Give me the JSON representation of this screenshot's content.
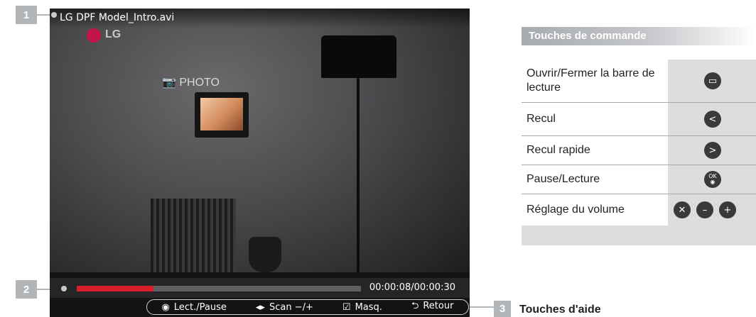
{
  "callouts": {
    "one": "1",
    "two": "2",
    "three": "3",
    "three_label": "Touches d'aide"
  },
  "player": {
    "file_title": "LG DPF Model_Intro.avi",
    "logo_text": "LG",
    "photo_label": "PHOTO",
    "progress": 0.27,
    "time_readout": "00:00:08/00:00:30",
    "help_bar": [
      {
        "glyph": "◉",
        "label": "Lect./Pause",
        "icon": "ok-button-icon"
      },
      {
        "glyph": "◂▸",
        "label": "Scan −/+",
        "icon": "left-right-arrows-icon"
      },
      {
        "glyph": "☑",
        "label": "Masq.",
        "icon": "checkbox-icon"
      },
      {
        "glyph": "⮌",
        "label": "Retour",
        "icon": "return-icon"
      }
    ]
  },
  "panel": {
    "title": "Touches de commande",
    "rows": [
      {
        "label": "Ouvrir/Fermer la barre de lecture",
        "buttons": [
          {
            "icon": "menu-bar-icon",
            "glyph": "▭"
          }
        ]
      },
      {
        "label": "Recul",
        "buttons": [
          {
            "icon": "left-arrow-icon",
            "glyph": "<"
          }
        ]
      },
      {
        "label": "Recul rapide",
        "buttons": [
          {
            "icon": "right-arrow-icon",
            "glyph": ">"
          }
        ]
      },
      {
        "label": "Pause/Lecture",
        "buttons": [
          {
            "icon": "ok-icon",
            "glyph": "OK"
          }
        ]
      },
      {
        "label": "Réglage du volume",
        "buttons": [
          {
            "icon": "mute-icon",
            "glyph": "✕"
          },
          {
            "icon": "volume-down-icon",
            "glyph": "–"
          },
          {
            "icon": "volume-up-icon",
            "glyph": "+"
          }
        ]
      }
    ]
  },
  "colors": {
    "badge": "#b2b5b8",
    "progress_fill": "#d7202c",
    "panel_bg": "#dcddde",
    "button_bg": "#3a3a3b"
  }
}
